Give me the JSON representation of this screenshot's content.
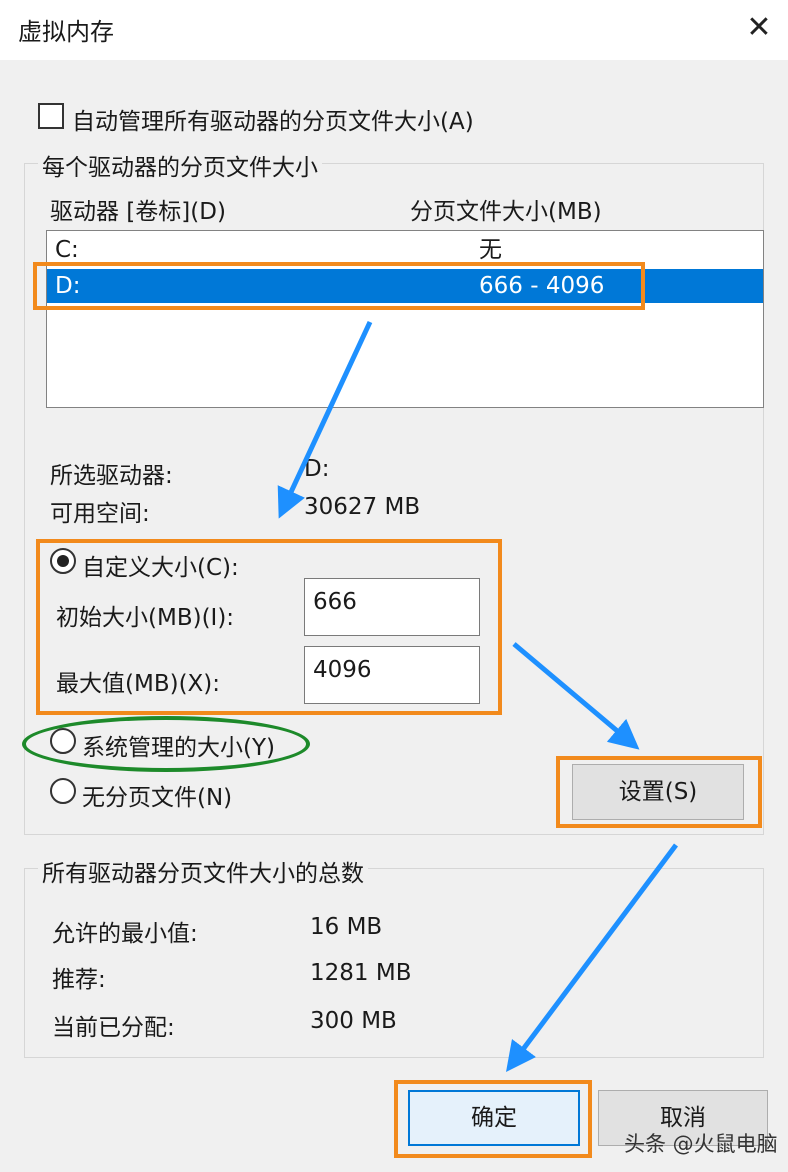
{
  "window": {
    "title": "虚拟内存",
    "close_icon": "✕"
  },
  "auto_manage": {
    "label": "自动管理所有驱动器的分页文件大小(A)",
    "checked": false
  },
  "per_drive": {
    "legend": "每个驱动器的分页文件大小",
    "col_drive": "驱动器 [卷标](D)",
    "col_size": "分页文件大小(MB)",
    "rows": [
      {
        "drive": "C:",
        "size": "无"
      },
      {
        "drive": "D:",
        "size": "666 - 4096"
      }
    ],
    "selected_drive_label": "所选驱动器:",
    "selected_drive_value": "D:",
    "free_space_label": "可用空间:",
    "free_space_value": "30627 MB",
    "custom_size_label": "自定义大小(C):",
    "initial_size_label": "初始大小(MB)(I):",
    "initial_size_value": "666",
    "max_size_label": "最大值(MB)(X):",
    "max_size_value": "4096",
    "system_managed_label": "系统管理的大小(Y)",
    "no_paging_label": "无分页文件(N)",
    "set_button": "设置(S)"
  },
  "totals": {
    "legend": "所有驱动器分页文件大小的总数",
    "min_label": "允许的最小值:",
    "min_value": "16 MB",
    "recommended_label": "推荐:",
    "recommended_value": "1281 MB",
    "current_label": "当前已分配:",
    "current_value": "300 MB"
  },
  "buttons": {
    "ok": "确定",
    "cancel": "取消"
  },
  "watermark": "头条 @火鼠电脑",
  "colors": {
    "selection": "#0078d7",
    "highlight_orange": "#f28a1c",
    "highlight_green": "#1d8a2a",
    "arrow_blue": "#1e90ff"
  }
}
